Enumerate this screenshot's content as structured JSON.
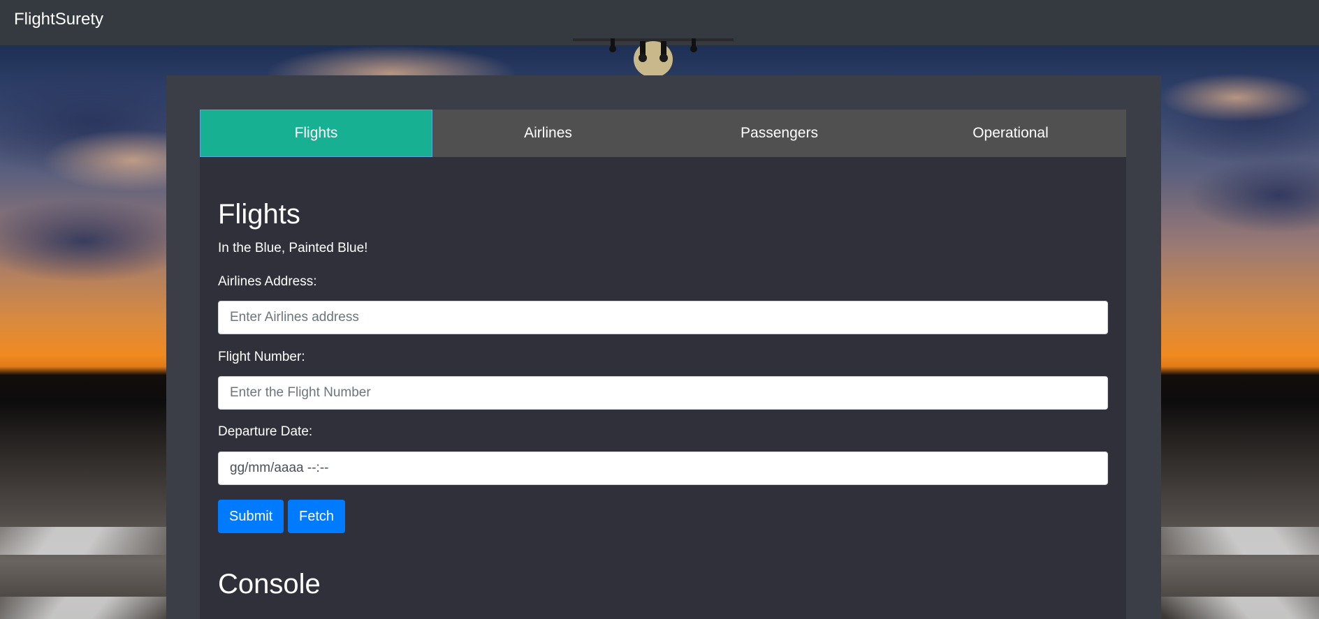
{
  "app": {
    "brand": "FlightSurety"
  },
  "tabs": [
    {
      "label": "Flights",
      "active": true
    },
    {
      "label": "Airlines",
      "active": false
    },
    {
      "label": "Passengers",
      "active": false
    },
    {
      "label": "Operational",
      "active": false
    }
  ],
  "flights": {
    "title": "Flights",
    "subtitle": "In the Blue, Painted Blue!",
    "airline_label": "Airlines Address:",
    "airline_placeholder": "Enter Airlines address",
    "flight_label": "Flight Number:",
    "flight_placeholder": "Enter the Flight Number",
    "date_label": "Departure Date:",
    "date_value": "gg/mm/aaaa --:--",
    "submit_label": "Submit",
    "fetch_label": "Fetch"
  },
  "console": {
    "title": "Console"
  },
  "colors": {
    "active_tab": "#17b092",
    "button": "#007bff",
    "navbar": "#343a40"
  }
}
